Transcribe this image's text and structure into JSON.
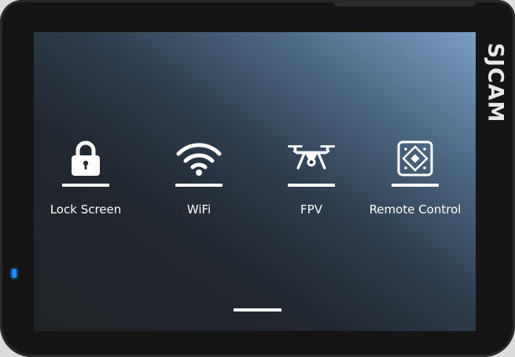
{
  "brand": {
    "logo_text": "SJCAM"
  },
  "menu": {
    "items": [
      {
        "label": "Lock Screen",
        "icon": "lock-icon"
      },
      {
        "label": "WiFi",
        "icon": "wifi-icon"
      },
      {
        "label": "FPV",
        "icon": "drone-icon"
      },
      {
        "label": "Remote Control",
        "icon": "remote-control-icon"
      }
    ]
  },
  "colors": {
    "screen_top_right": "#7b9ec4",
    "screen_bottom_left": "#1f2226",
    "bezel": "#151515",
    "led": "#1e8cff",
    "text": "#ffffff"
  }
}
